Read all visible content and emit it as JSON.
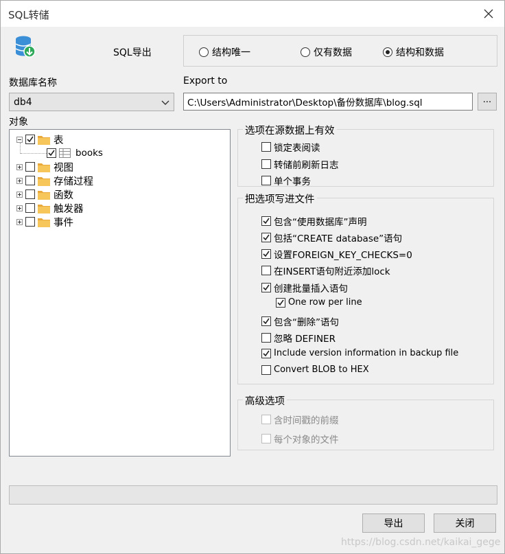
{
  "window": {
    "title": "SQL转储"
  },
  "export_mode": {
    "label": "SQL导出",
    "options": [
      {
        "label": "结构唯一",
        "selected": false
      },
      {
        "label": "仅有数据",
        "selected": false
      },
      {
        "label": "结构和数据",
        "selected": true
      }
    ]
  },
  "database": {
    "label": "数据库名称",
    "value": "db4"
  },
  "export_to": {
    "label": "Export to",
    "value": "C:\\Users\\Administrator\\Desktop\\备份数据库\\blog.sql",
    "browse_label": "..."
  },
  "objects": {
    "label": "对象",
    "tree": [
      {
        "label": "表",
        "checked": true,
        "expanded": true,
        "children": [
          {
            "label": "books",
            "checked": true
          }
        ]
      },
      {
        "label": "视图",
        "checked": false
      },
      {
        "label": "存储过程",
        "checked": false
      },
      {
        "label": "函数",
        "checked": false
      },
      {
        "label": "触发器",
        "checked": false
      },
      {
        "label": "事件",
        "checked": false
      }
    ]
  },
  "source_options": {
    "title": "选项在源数据上有效",
    "items": [
      {
        "label": "锁定表阅读",
        "checked": false
      },
      {
        "label": "转储前刷新日志",
        "checked": false
      },
      {
        "label": "单个事务",
        "checked": false
      }
    ]
  },
  "file_options": {
    "title": "把选项写进文件",
    "items": [
      {
        "label": "包含“使用数据库”声明",
        "checked": true
      },
      {
        "label": "包括“CREATE database”语句",
        "checked": true
      },
      {
        "label": "设置FOREIGN_KEY_CHECKS=0",
        "checked": true
      },
      {
        "label": "在INSERT语句附近添加lock",
        "checked": false
      },
      {
        "label": "创建批量插入语句",
        "checked": true
      },
      {
        "label": "One row per line",
        "checked": true
      },
      {
        "label": "包含“删除”语句",
        "checked": true
      },
      {
        "label": "忽略 DEFINER",
        "checked": false
      },
      {
        "label": "Include version information in backup file",
        "checked": true
      },
      {
        "label": "Convert BLOB to HEX",
        "checked": false
      }
    ]
  },
  "advanced": {
    "title": "高级选项",
    "items": [
      {
        "label": "含时间戳的前缀",
        "checked": false
      },
      {
        "label": "每个对象的文件",
        "checked": false
      }
    ]
  },
  "buttons": {
    "export": "导出",
    "close": "关闭"
  },
  "watermark": "https://blog.csdn.net/kaikai_gege",
  "colors": {
    "folder": "#f7c65a",
    "folder_dark": "#e8a93a",
    "db_icon": "#3b8fd6",
    "db_badge": "#2eaa5a"
  }
}
